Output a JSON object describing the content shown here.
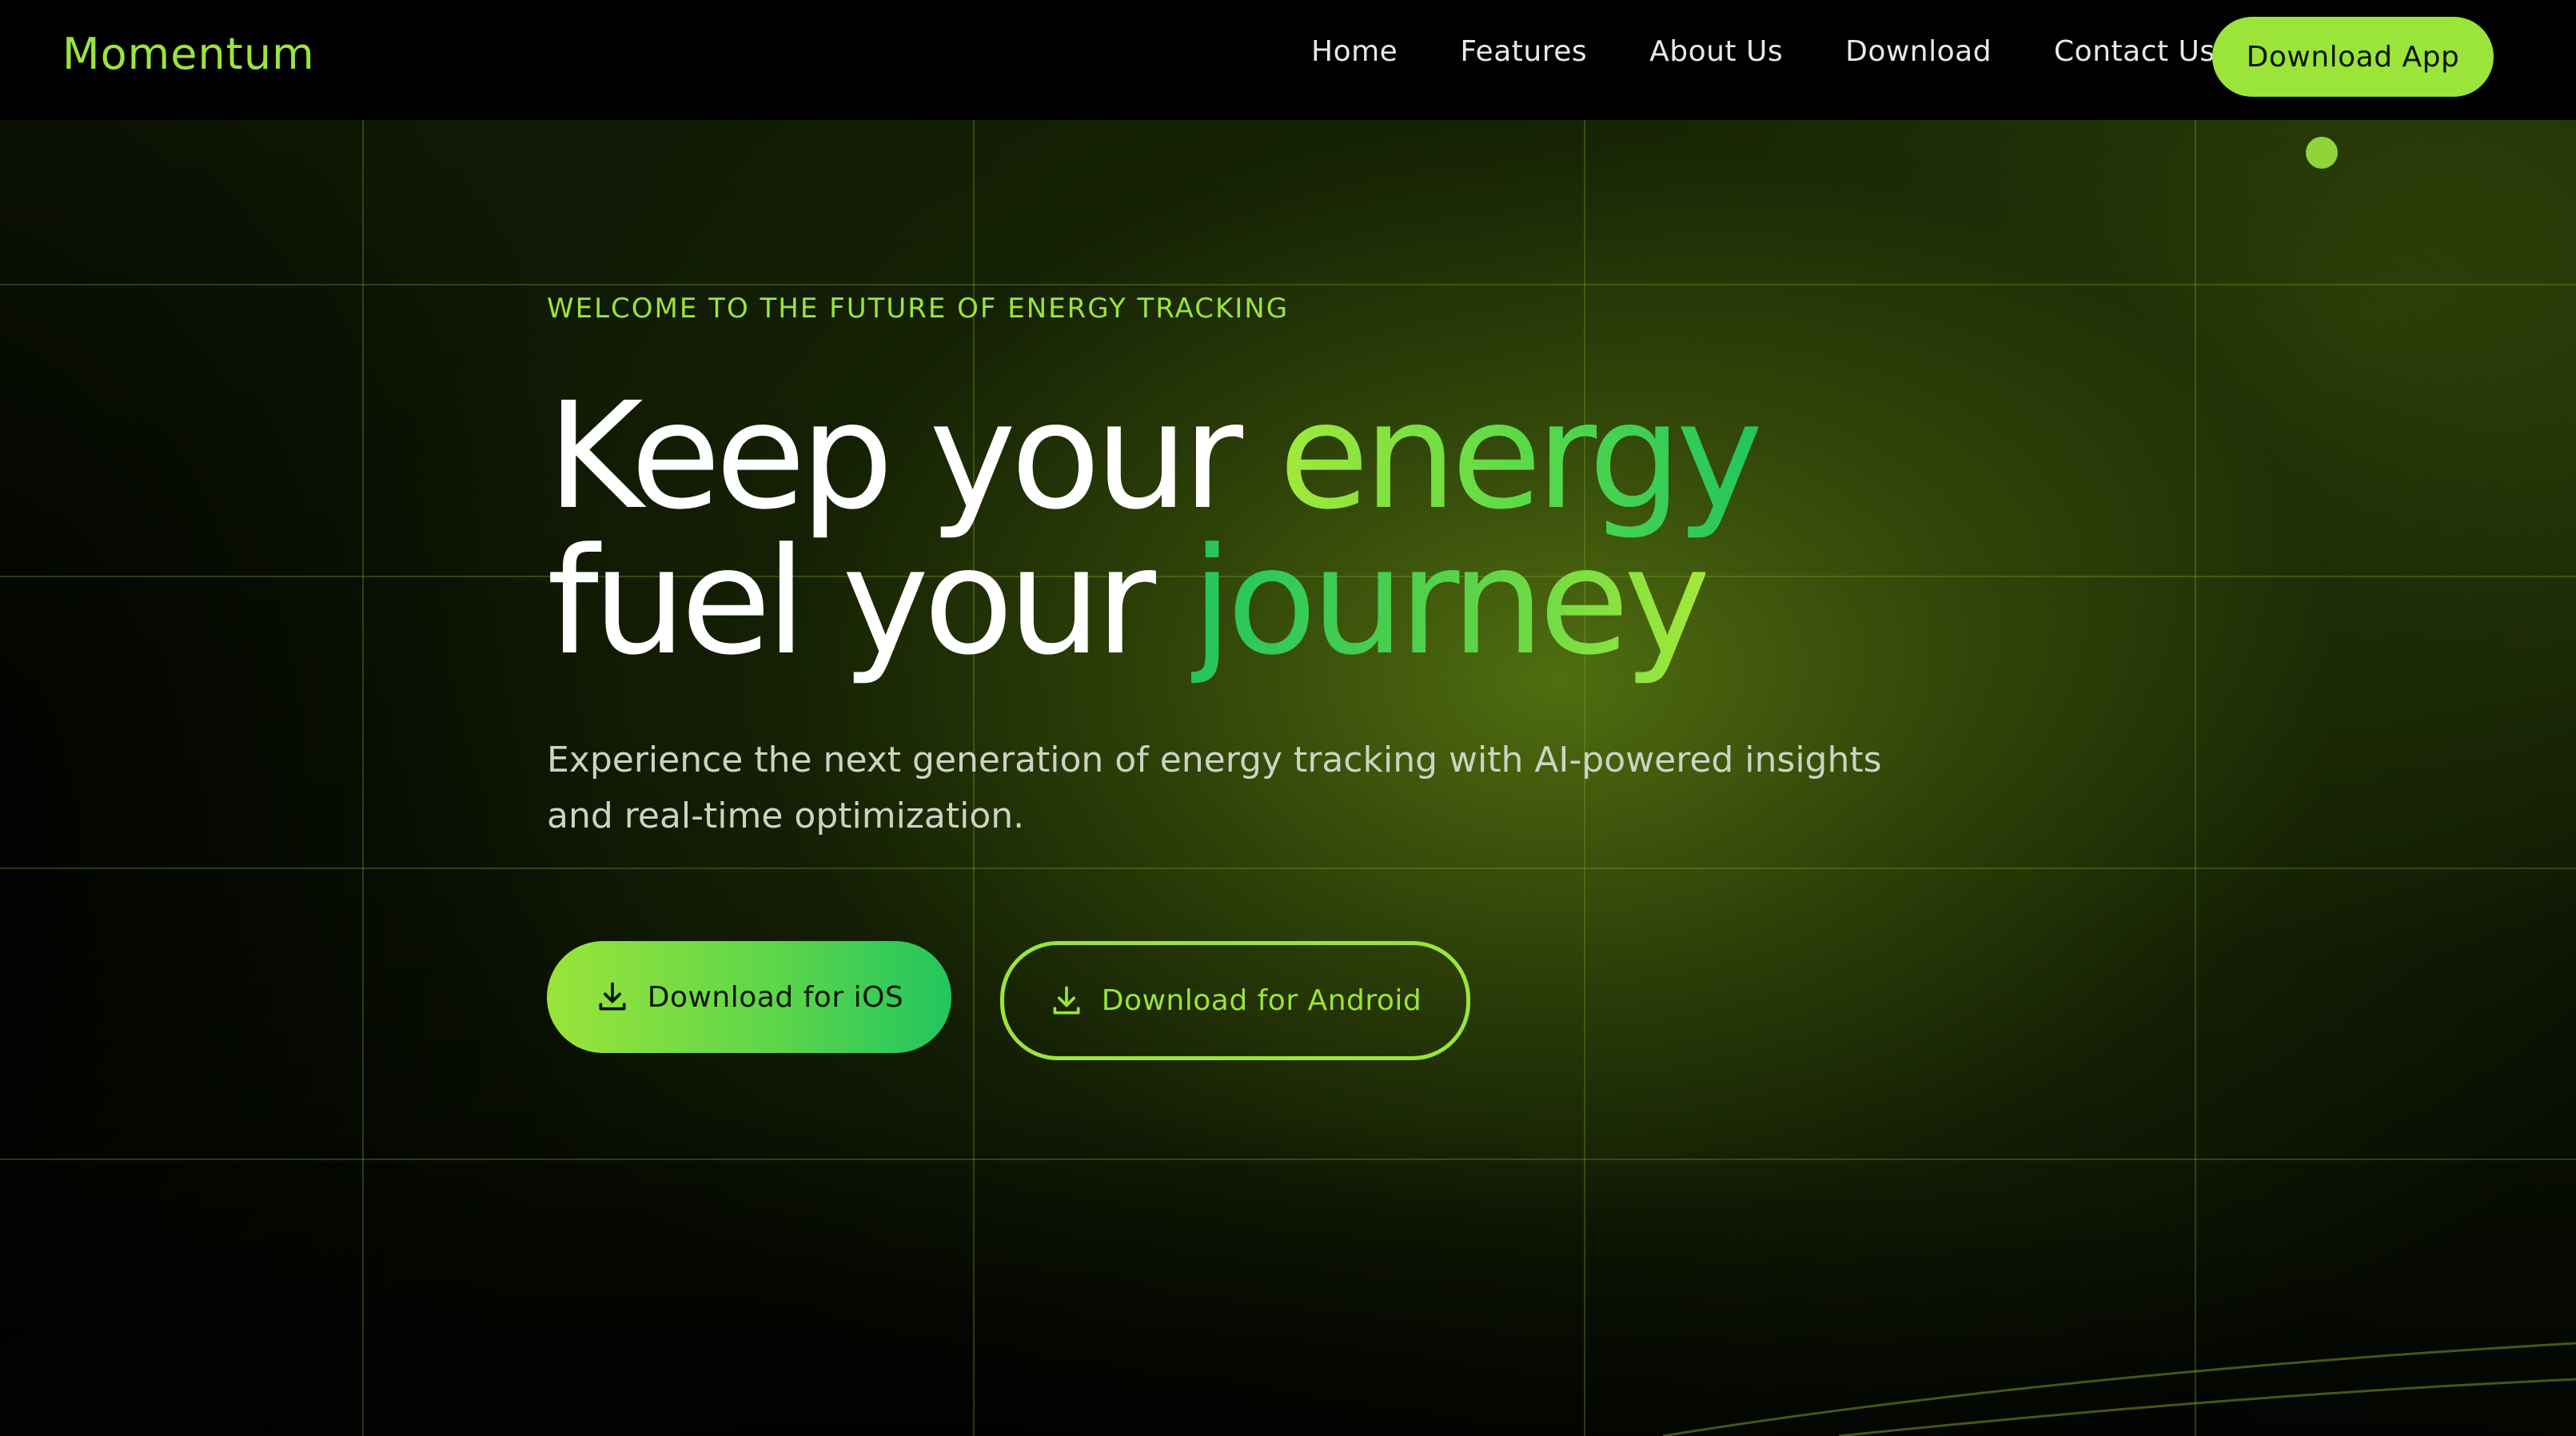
{
  "brand": {
    "name": "Momentum"
  },
  "nav": {
    "links": [
      "Home",
      "Features",
      "About Us",
      "Download",
      "Contact Us"
    ],
    "cta_label": "Download App"
  },
  "hero": {
    "kicker": "WELCOME TO THE FUTURE OF ENERGY TRACKING",
    "headline": {
      "line1_white": "Keep your ",
      "line1_accent": "energy",
      "line2_white": "fuel your ",
      "line2_accent": "journey"
    },
    "subtitle": "Experience the next generation of energy tracking with AI-powered insights and real-time optimization.",
    "buttons": {
      "ios_label": "Download for iOS",
      "android_label": "Download for Android"
    }
  },
  "icons": {
    "download": "download-icon"
  },
  "colors": {
    "accent": "#9be43a",
    "accent_green": "#22c55e",
    "background": "#000000",
    "text": "#ffffff",
    "muted_text": "#cdd3c4"
  }
}
